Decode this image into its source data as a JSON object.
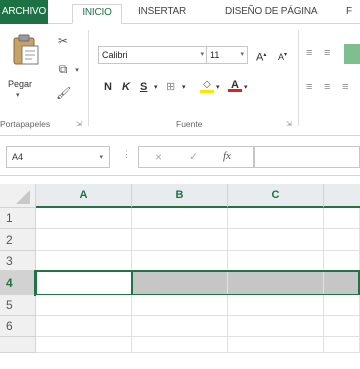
{
  "tabs": {
    "file": "ARCHIVO",
    "home": "INICIO",
    "insert": "INSERTAR",
    "page_layout": "DISEÑO DE PÁGINA",
    "more": "F"
  },
  "ribbon": {
    "clipboard": {
      "paste_label": "Pegar",
      "group_label": "Portapapeles"
    },
    "font": {
      "font_name": "Calibri",
      "font_size": "11",
      "bold": "N",
      "italic": "K",
      "underline": "S",
      "group_label": "Fuente"
    }
  },
  "formula_bar": {
    "name_box": "A4",
    "fx": "fx",
    "cancel": "×",
    "enter": "✓",
    "content": ""
  },
  "grid": {
    "columns": [
      "A",
      "B",
      "C"
    ],
    "rows": [
      "1",
      "2",
      "3",
      "4",
      "5",
      "6"
    ],
    "selected_row": "4",
    "active_cell": "A4"
  },
  "colors": {
    "accent": "#217346",
    "file_tab": "#1e7145",
    "selection": "#c6c6c6"
  }
}
